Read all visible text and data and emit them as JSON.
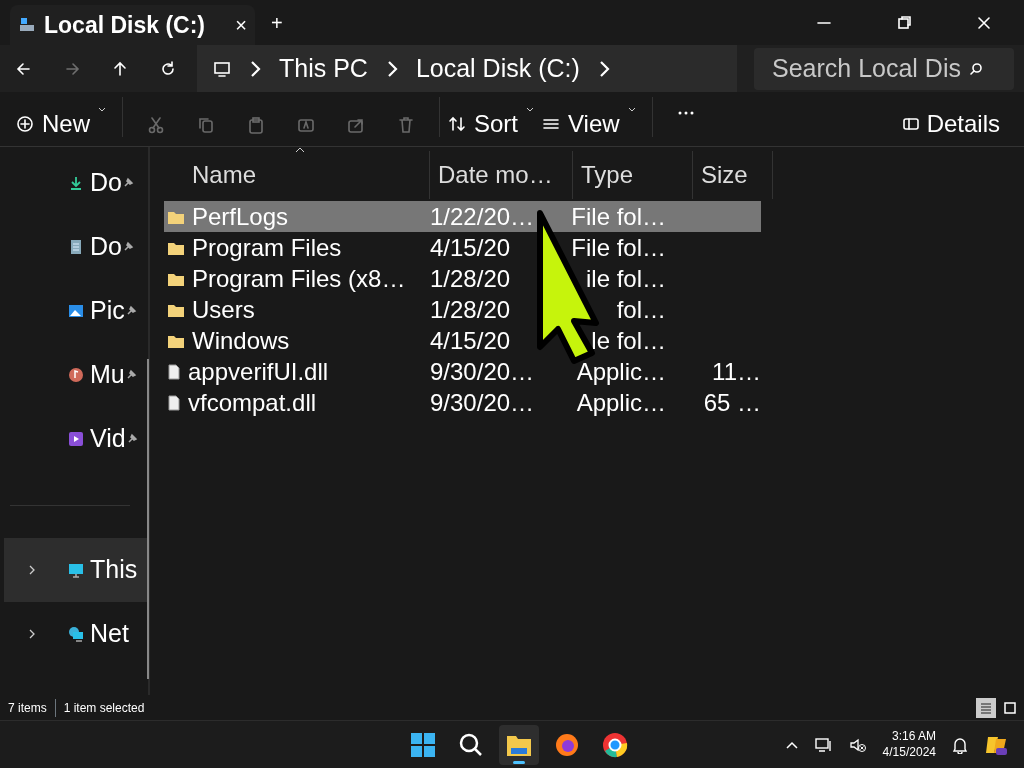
{
  "tab": {
    "title": "Local Disk (C:)",
    "close": "×",
    "new_tab": "+"
  },
  "nav_buttons": [
    {
      "kind": "back",
      "disabled": false
    },
    {
      "kind": "forward",
      "disabled": true
    },
    {
      "kind": "up",
      "disabled": false
    },
    {
      "kind": "refresh",
      "disabled": false
    }
  ],
  "breadcrumb": [
    "This PC",
    "Local Disk (C:)"
  ],
  "search": {
    "placeholder": "Search Local Dis"
  },
  "commands": [
    {
      "kind": "new",
      "label": "New",
      "disabled": false
    },
    {
      "kind": "cut",
      "disabled": true
    },
    {
      "kind": "copy",
      "disabled": true
    },
    {
      "kind": "paste",
      "disabled": true
    },
    {
      "kind": "rename",
      "disabled": true
    },
    {
      "kind": "share",
      "disabled": true
    },
    {
      "kind": "delete",
      "disabled": true
    },
    {
      "kind": "sort",
      "label": "Sort",
      "disabled": false
    },
    {
      "kind": "view",
      "label": "View",
      "disabled": false
    },
    {
      "kind": "more",
      "disabled": false
    }
  ],
  "details": {
    "label": "Details"
  },
  "sidebar": {
    "items": [
      {
        "kind": "downloads",
        "label": "Do",
        "pinned": true,
        "expandable": false,
        "selected": false
      },
      {
        "kind": "documents",
        "label": "Do",
        "pinned": true,
        "expandable": false,
        "selected": false
      },
      {
        "kind": "pictures",
        "label": "Pic",
        "pinned": true,
        "expandable": false,
        "selected": false
      },
      {
        "kind": "music",
        "label": "Mu",
        "pinned": true,
        "expandable": false,
        "selected": false
      },
      {
        "kind": "videos",
        "label": "Vid",
        "pinned": true,
        "expandable": false,
        "selected": false
      },
      {
        "kind": "pc",
        "label": "This",
        "pinned": false,
        "expandable": true,
        "selected": true
      },
      {
        "kind": "network",
        "label": "Net",
        "pinned": false,
        "expandable": true,
        "selected": false
      }
    ]
  },
  "table": {
    "columns": [
      {
        "label": "Name",
        "sorted": true
      },
      {
        "label": "Date mo…",
        "sorted": false
      },
      {
        "label": "Type",
        "sorted": false
      },
      {
        "label": "Size",
        "sorted": false
      }
    ],
    "rows": [
      {
        "kind": "folder",
        "name": "PerfLogs",
        "date": "1/22/20…",
        "type": "File fol…",
        "selected": true
      },
      {
        "kind": "folder",
        "name": "Program Files",
        "date": "4/15/20",
        "type": "File fol…",
        "selected": false
      },
      {
        "kind": "folder",
        "name": "Program Files (x8…",
        "date": "1/28/20",
        "type": "ile fol…",
        "selected": false
      },
      {
        "kind": "folder",
        "name": "Users",
        "date": "1/28/20",
        "type": "fol…",
        "selected": false
      },
      {
        "kind": "folder",
        "name": "Windows",
        "date": "4/15/20",
        "type": "le fol…",
        "selected": false
      },
      {
        "kind": "file",
        "name": "appverifUI.dll",
        "date": "9/30/20…",
        "type": "Applic…",
        "size": "11…",
        "selected": false
      },
      {
        "kind": "file",
        "name": "vfcompat.dll",
        "date": "9/30/20…",
        "type": "Applic…",
        "size": "65 …",
        "selected": false
      }
    ]
  },
  "status_bar": {
    "count": "7 items",
    "selection": "1 item selected",
    "views": [
      {
        "kind": "details",
        "selected": true
      },
      {
        "kind": "tiles",
        "selected": false
      }
    ]
  },
  "taskbar": {
    "apps": [
      {
        "kind": "start",
        "active": false
      },
      {
        "kind": "search",
        "active": false
      },
      {
        "kind": "explorer",
        "active": true
      },
      {
        "kind": "firefox",
        "active": false
      },
      {
        "kind": "chrome",
        "active": false
      }
    ],
    "time": "3:16 AM",
    "date": "4/15/2024"
  }
}
